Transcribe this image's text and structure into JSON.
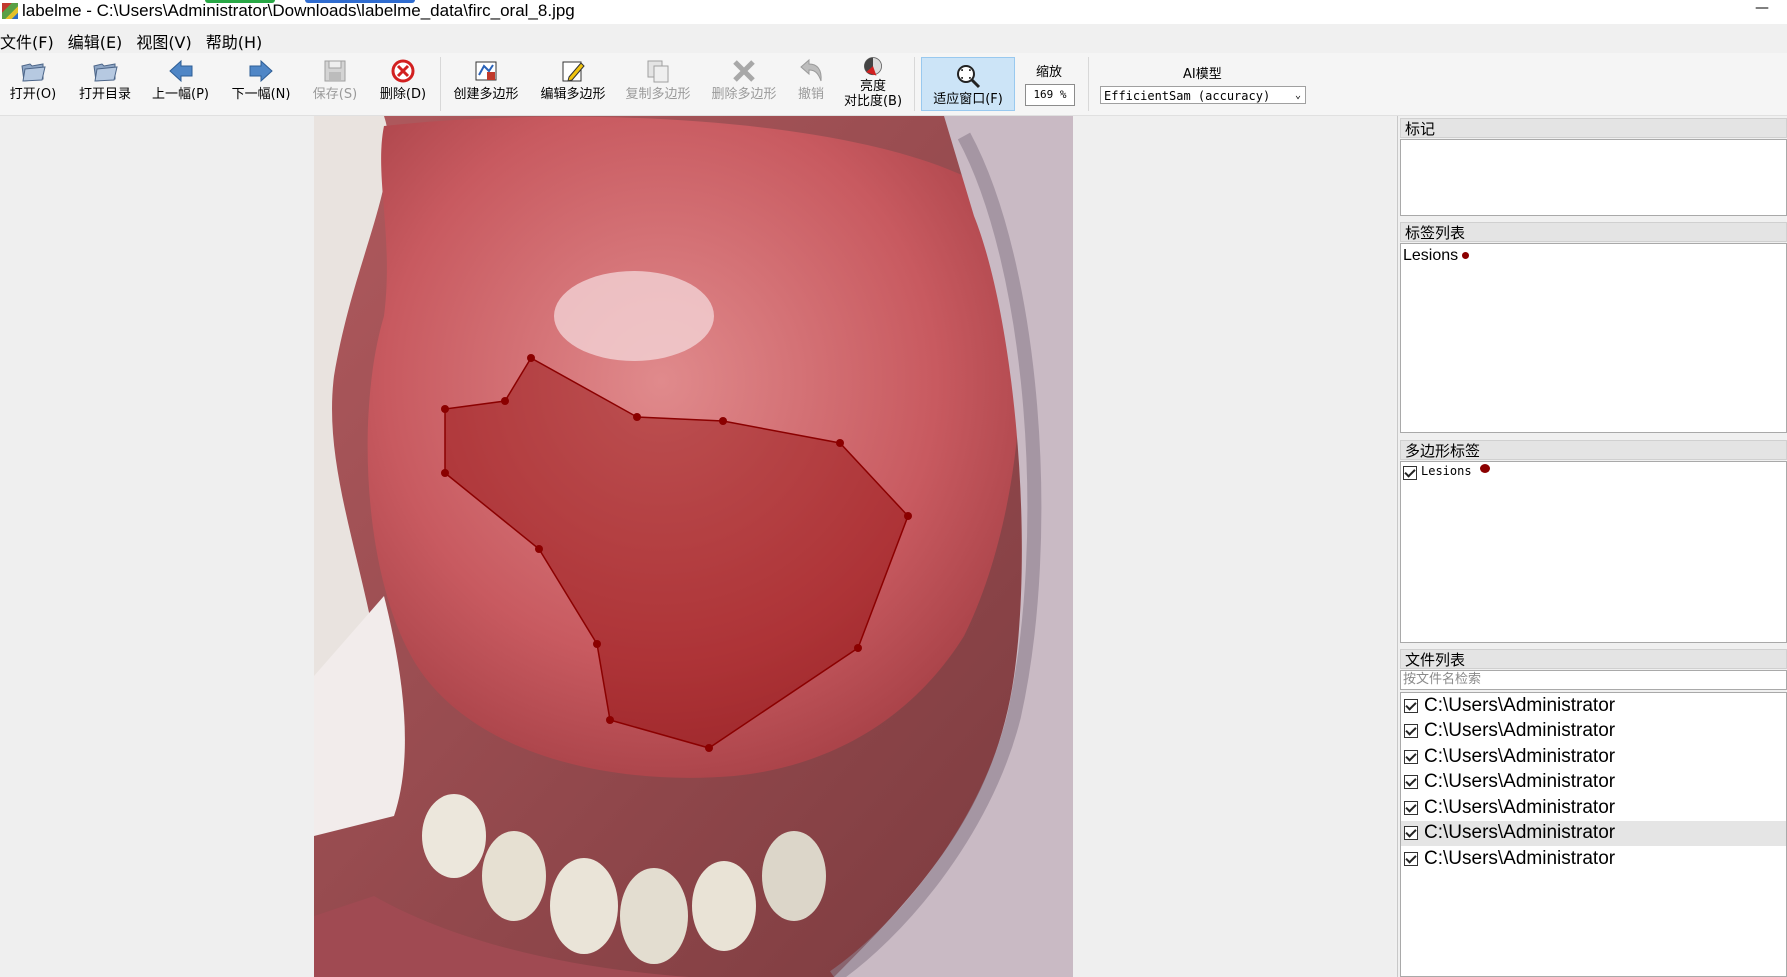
{
  "window": {
    "title": "labelme - C:\\Users\\Administrator\\Downloads\\labelme_data\\firc_oral_8.jpg",
    "minimize": "—"
  },
  "menu": [
    "文件(F)",
    "编辑(E)",
    "视图(V)",
    "帮助(H)"
  ],
  "toolbar": {
    "open": "打开(O)",
    "open_dir": "打开目录",
    "prev": "上一幅(P)",
    "next": "下一幅(N)",
    "save": "保存(S)",
    "delete": "删除(D)",
    "create_polygon": "创建多边形",
    "edit_polygon": "编辑多边形",
    "copy_polygon": "复制多边形",
    "delete_polygon": "删除多边形",
    "undo": "撤销",
    "brightness_line1": "亮度",
    "brightness_line2": "对比度(B)",
    "fit_window": "适应窗口(F)",
    "zoom_label": "缩放",
    "zoom_value": "169 %",
    "ai_label": "AI模型",
    "ai_model": "EfficientSam (accuracy)"
  },
  "panels": {
    "flags_title": "标记",
    "label_list_title": "标签列表",
    "polygon_labels_title": "多边形标签",
    "file_list_title": "文件列表",
    "search_placeholder": "按文件名检索"
  },
  "labels": [
    {
      "name": "Lesions",
      "color": "#8b0000"
    }
  ],
  "polygons": [
    {
      "name": "Lesions",
      "checked": true,
      "color": "#8b0000"
    }
  ],
  "files": [
    {
      "path": "C:\\Users\\Administrator",
      "checked": true,
      "selected": false
    },
    {
      "path": "C:\\Users\\Administrator",
      "checked": true,
      "selected": false
    },
    {
      "path": "C:\\Users\\Administrator",
      "checked": true,
      "selected": false
    },
    {
      "path": "C:\\Users\\Administrator",
      "checked": true,
      "selected": false
    },
    {
      "path": "C:\\Users\\Administrator",
      "checked": true,
      "selected": false
    },
    {
      "path": "C:\\Users\\Administrator",
      "checked": true,
      "selected": true
    },
    {
      "path": "C:\\Users\\Administrator",
      "checked": true,
      "selected": false
    }
  ],
  "colors": {
    "polygon_fill": "#8b0000",
    "accent_fit": "#cce4f7"
  }
}
